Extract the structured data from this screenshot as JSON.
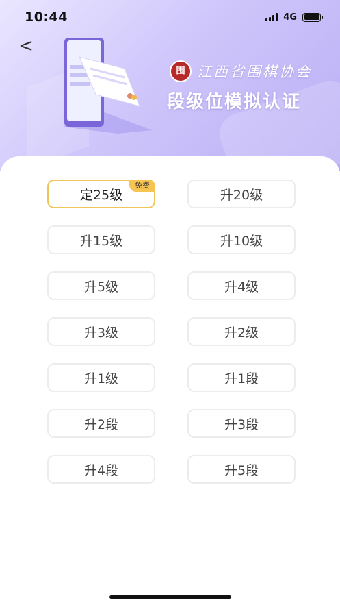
{
  "status_bar": {
    "time": "10:44",
    "network": "4G"
  },
  "hero": {
    "org_name": "江西省围棋协会",
    "title": "段级位模拟认证",
    "seal_text": "围"
  },
  "back_symbol": "<",
  "levels": [
    {
      "label": "定25级",
      "badge": "免费",
      "selected": true
    },
    {
      "label": "升20级"
    },
    {
      "label": "升15级"
    },
    {
      "label": "升10级"
    },
    {
      "label": "升5级"
    },
    {
      "label": "升4级"
    },
    {
      "label": "升3级"
    },
    {
      "label": "升2级"
    },
    {
      "label": "升1级"
    },
    {
      "label": "升1段"
    },
    {
      "label": "升2段"
    },
    {
      "label": "升3段"
    },
    {
      "label": "升4段"
    },
    {
      "label": "升5段"
    }
  ],
  "colors": {
    "selected_border": "#f2c55c",
    "badge_bg": "#f6c452",
    "hero_bg": "#cfc6fb"
  }
}
